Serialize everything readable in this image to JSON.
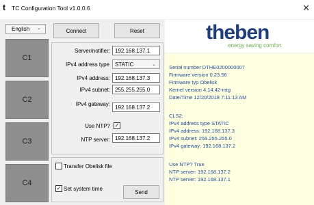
{
  "window": {
    "title": "TC Configuration Tool v1.0.0.6",
    "app_icon": "t",
    "close_icon": "close-icon"
  },
  "language": {
    "selected": "English"
  },
  "clients": [
    "C1",
    "C2",
    "C3",
    "C4"
  ],
  "toolbar": {
    "connect_label": "Connect",
    "reset_label": "Reset"
  },
  "form": {
    "server_label": "Server/notifier:",
    "server_value": "192.168.137.1",
    "addr_type_label": "IPv4 address type",
    "addr_type_value": "STATIC",
    "address_label": "IPv4 address:",
    "address_value": "192.168.137.3",
    "subnet_label": "IPv4 subnet:",
    "subnet_value": "255.255.255.0",
    "gateway_label": "IPv4 gateway:",
    "gateway_value": "192.168.137.2",
    "ntp_use_label": "Use NTP?",
    "ntp_use_checked": true,
    "ntp_server_label": "NTP server:",
    "ntp_server_value": "192.168.137.2"
  },
  "actions": {
    "transfer_label": "Transfer Obelisk file",
    "transfer_checked": false,
    "set_time_label": "Set system time",
    "set_time_checked": true,
    "send_label": "Send"
  },
  "logo": {
    "word": "theben",
    "tagline": "energy saving comfort",
    "color": "#1f3f7a",
    "tag_color": "#6ab04c"
  },
  "info": {
    "serial": "Serial number DTHE0200000007",
    "firmware_version": "Firmware version 0.23.56",
    "firmware_type": "Firmware typ Obelisk",
    "kernel": "Kernel version 4.14.42-mtg",
    "datetime": "Date/Time 12/20/2018 7:11:13 AM",
    "cls2": "CLS2:",
    "addr_type": "IPv4 address type STATIC",
    "address": "IPv4 address: 192.168.137.3",
    "subnet": "IPv4 subnet: 255.255.255.0",
    "gateway": "IPv4 gateway: 192.168.137.2",
    "use_ntp": "Use NTP? True",
    "ntp1": "NTP server: 192.168.137.2",
    "ntp2": "NTP server: 192.168.137.1"
  }
}
